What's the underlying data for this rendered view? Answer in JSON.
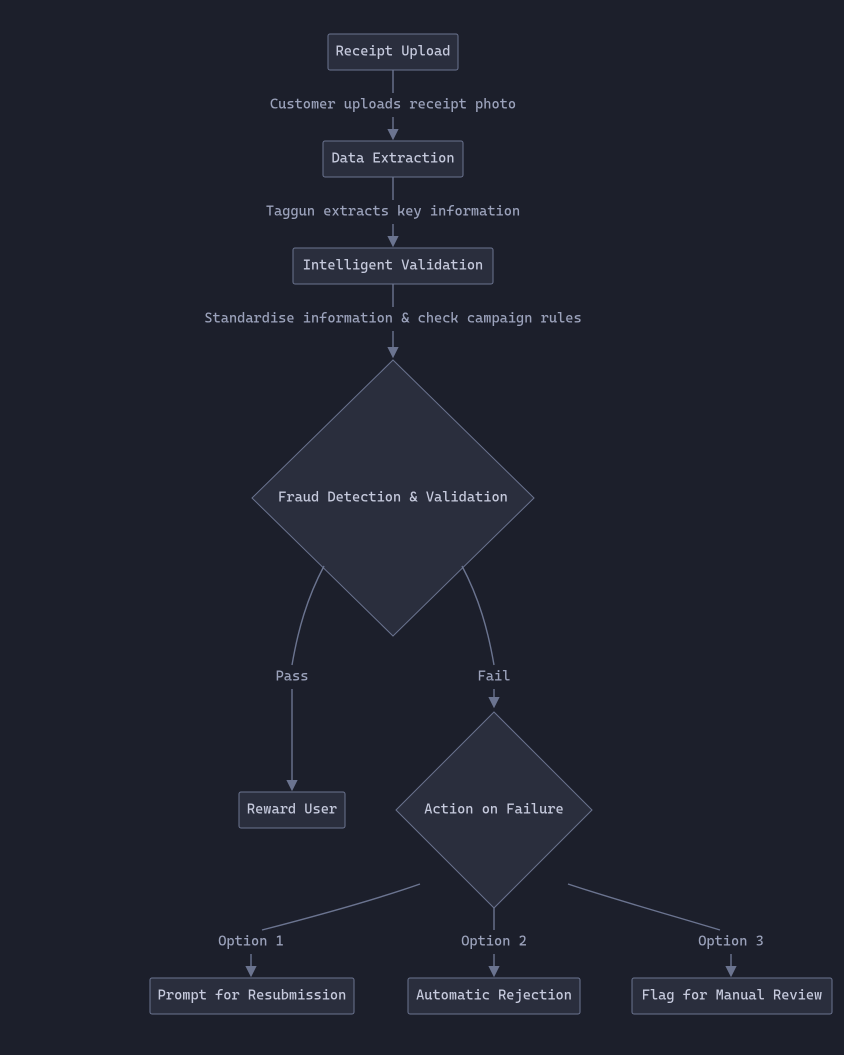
{
  "nodes": {
    "receipt_upload": {
      "label": "Receipt Upload"
    },
    "data_extraction": {
      "label": "Data Extraction"
    },
    "intelligent_validation": {
      "label": "Intelligent Validation"
    },
    "fraud_detection": {
      "label": "Fraud Detection & Validation"
    },
    "reward_user": {
      "label": "Reward User"
    },
    "action_on_failure": {
      "label": "Action on Failure"
    },
    "prompt_resubmission": {
      "label": "Prompt for Resubmission"
    },
    "automatic_rejection": {
      "label": "Automatic Rejection"
    },
    "flag_manual_review": {
      "label": "Flag for Manual Review"
    }
  },
  "edges": {
    "upload_to_extraction": {
      "label": "Customer uploads receipt photo"
    },
    "extraction_to_validation": {
      "label": "Taggun extracts key information"
    },
    "validation_to_fraud": {
      "label": "Standardise information & check campaign rules"
    },
    "fraud_pass": {
      "label": "Pass"
    },
    "fraud_fail": {
      "label": "Fail"
    },
    "fail_option1": {
      "label": "Option 1"
    },
    "fail_option2": {
      "label": "Option 2"
    },
    "fail_option3": {
      "label": "Option 3"
    }
  },
  "colors": {
    "bg": "#1c1f2b",
    "node_fill": "#2a2e3d",
    "stroke": "#6b7490",
    "text": "#c6cadd",
    "label": "#9ba2bb"
  }
}
